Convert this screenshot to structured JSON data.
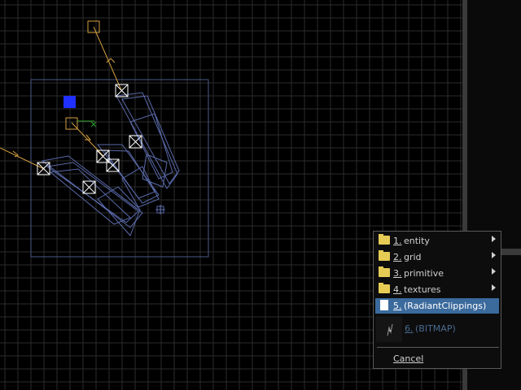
{
  "viewport": {
    "name": "2D grid view",
    "grid_color": "#2c2c2c",
    "selection_color": "#4a5a8a",
    "brush_color": "#5a6aaa",
    "light_color": "#d4a040"
  },
  "context_menu": {
    "items": [
      {
        "number": "1.",
        "label": "entity",
        "icon": "folder-icon",
        "has_submenu": true
      },
      {
        "number": "2.",
        "label": "grid",
        "icon": "folder-icon",
        "has_submenu": true
      },
      {
        "number": "3.",
        "label": "primitive",
        "icon": "folder-icon",
        "has_submenu": true
      },
      {
        "number": "4.",
        "label": "textures",
        "icon": "folder-icon",
        "has_submenu": true
      },
      {
        "number": "5.",
        "label": "(RadiantClippings)",
        "icon": "document-icon",
        "selected": true
      },
      {
        "number": "6.",
        "label": "(BITMAP)",
        "icon": "bitmap-thumbnail",
        "disabled": true
      }
    ],
    "cancel_label": "Cancel",
    "selected_color": "#3b6a9c"
  }
}
